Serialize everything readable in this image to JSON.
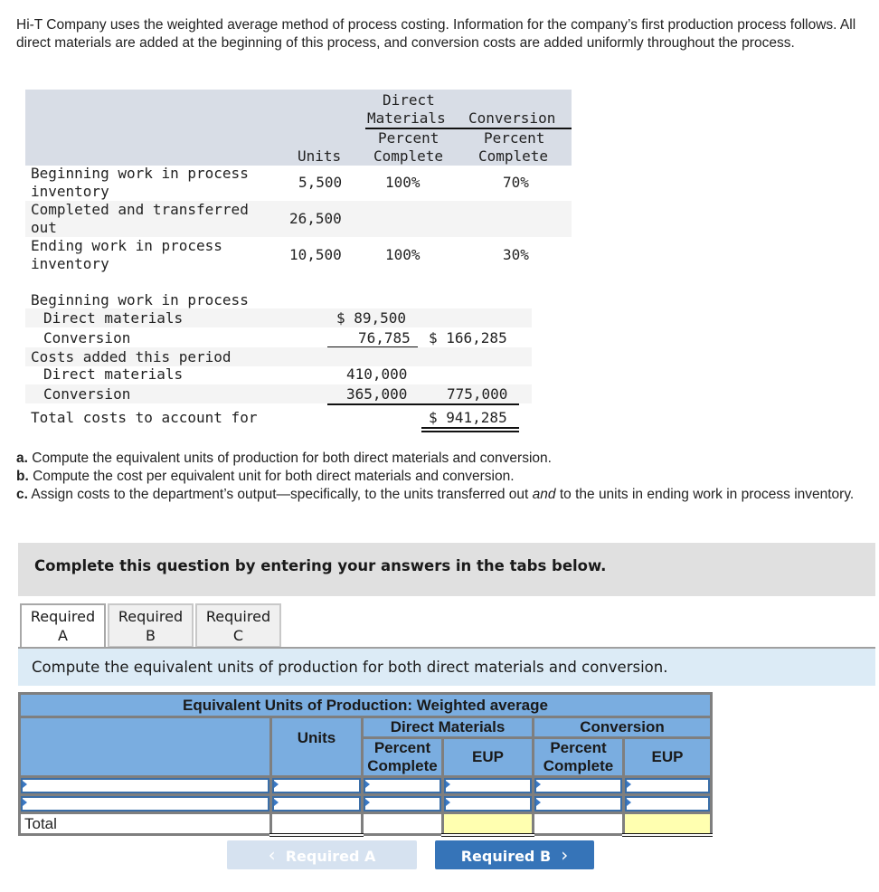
{
  "intro": "Hi-T Company uses the weighted average method of process costing. Information for the company’s first production process follows. All direct materials are added at the beginning of this process, and conversion costs are added uniformly throughout the process.",
  "units_table": {
    "headers": {
      "units": "Units",
      "dm_group_line1": "Direct",
      "dm_group_line2": "Materials",
      "conv_group": "Conversion",
      "dm_pct_line1": "Percent",
      "dm_pct_line2": "Complete",
      "conv_pct_line1": "Percent",
      "conv_pct_line2": "Complete"
    },
    "rows": [
      {
        "label_line1": "Beginning work in process",
        "label_line2": "inventory",
        "units": "5,500",
        "dm_pct": "100%",
        "conv_pct": "70%"
      },
      {
        "label_line1": "Completed and transferred",
        "label_line2": "out",
        "units": "26,500",
        "dm_pct": "",
        "conv_pct": ""
      },
      {
        "label_line1": "Ending work in process",
        "label_line2": "inventory",
        "units": "10,500",
        "dm_pct": "100%",
        "conv_pct": "30%"
      }
    ]
  },
  "costs_table": {
    "rows": [
      {
        "label": "Beginning work in process",
        "col1": "",
        "col2": ""
      },
      {
        "label": "Direct materials",
        "col1": "$ 89,500",
        "col2": ""
      },
      {
        "label": "Conversion",
        "col1": "76,785",
        "col2": "$ 166,285"
      },
      {
        "label": "Costs added this period",
        "col1": "",
        "col2": ""
      },
      {
        "label": "Direct materials",
        "col1": "410,000",
        "col2": ""
      },
      {
        "label": "Conversion",
        "col1": "365,000",
        "col2": "775,000"
      },
      {
        "label": "Total costs to account for",
        "col1": "",
        "col2": "$ 941,285"
      }
    ]
  },
  "questions": [
    {
      "letter": "a.",
      "text": " Compute the equivalent units of production for both direct materials and conversion."
    },
    {
      "letter": "b.",
      "text": " Compute the cost per equivalent unit for both direct materials and conversion."
    },
    {
      "letter": "c.",
      "text_before": " Assign costs to the department’s output—specifically, to the units transferred out ",
      "text_italic": "and",
      "text_after": " to the units in ending work in process inventory."
    }
  ],
  "banner": "Complete this question by entering your answers in the tabs below.",
  "tabs": [
    {
      "line1": "Required",
      "line2": "A",
      "active": true
    },
    {
      "line1": "Required",
      "line2": "B",
      "active": false
    },
    {
      "line1": "Required",
      "line2": "C",
      "active": false
    }
  ],
  "instruction": "Compute the equivalent units of production for both direct materials and conversion.",
  "eup_table": {
    "title": "Equivalent Units of Production: Weighted average",
    "dm_group": "Direct Materials",
    "conv_group": "Conversion",
    "units": "Units",
    "pct_line1": "Percent",
    "pct_line2": "Complete",
    "eup": "EUP",
    "total_label": "Total",
    "input_rows": [
      {
        "label": "",
        "units": "",
        "dm_pct": "",
        "dm_eup": "",
        "conv_pct": "",
        "conv_eup": ""
      },
      {
        "label": "",
        "units": "",
        "dm_pct": "",
        "dm_eup": "",
        "conv_pct": "",
        "conv_eup": ""
      }
    ]
  },
  "nav": {
    "prev_label": "Required A",
    "next_label": "Required B",
    "prev_chevron": "‹",
    "next_chevron": "›"
  },
  "colors": {
    "header_blue": "#7aade0",
    "next_button": "#3674b8",
    "prev_button_disabled": "#d6e2f0",
    "total_highlight": "#ffffb0",
    "instruction_bg": "#dcebf6"
  }
}
